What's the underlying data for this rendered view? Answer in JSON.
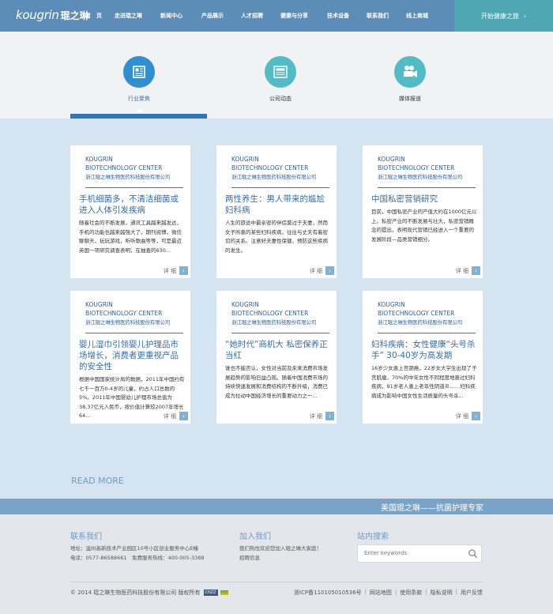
{
  "header": {
    "logo_en": "kougrin",
    "logo_cn": "琨之琳",
    "nav": [
      "首　页",
      "走进琨之琳",
      "新闻中心",
      "产品展示",
      "人才招聘",
      "健康与分享",
      "技术设备",
      "联系我们",
      "线上商城"
    ],
    "cta": "开始健康之旅",
    "cta_arrow": "›"
  },
  "tabs": [
    {
      "label": "行业聚焦",
      "icon": "newspaper-icon",
      "active": true
    },
    {
      "label": "公司动态",
      "icon": "news-document-icon",
      "active": false
    },
    {
      "label": "媒体报道",
      "icon": "video-camera-icon",
      "active": false
    }
  ],
  "brand": {
    "line1": "KOUGRIN",
    "line2": "BIOTECHNOLOGY CENTER",
    "line3": "浙江琨之琳生物医药科技股份有限公司"
  },
  "cards": [
    {
      "title": "手机细菌多，不清洁细菌或进入人体引发疾病",
      "body": "随着社会的不断发展，通讯工具越来越发达，手机的功能也越来越强大了，期刊阅博，微信聊聊天，玩玩游戏，听听歌曲等等，可是最近英国一项研究调查表明，在抽查的630...",
      "more": "详 细"
    },
    {
      "title": "两性养生：男人带来的尴尬妇科病",
      "body": "人生的旅途中最亲密的伴侣莫过于夫妻，然而女子所患的某些妇科疾病，往往与丈夫有着密切的关系。注意好夫妻性保健，预防这些疾病的发生。",
      "more": "详 细"
    },
    {
      "title": "中国私密营销研究",
      "body": "目前，中国私密产业的产值大约在1000亿元以上。私密产业的不断发展与壮大，私密营销概念的提出，表明现代营销已经进入一个重要的发展阶段—品类营销细分。",
      "more": "详 细"
    },
    {
      "title": "婴儿湿巾引领婴儿护理品市场增长，消费者更重视产品的安全性",
      "body": "根据中国国家统计局的数据，2011年中国约有七千一百万0-4岁的儿童，约占人口总数的5%。2011年中国婴幼儿护理市场总值为38.37亿元人民币，按价值计算较2007年增长64...",
      "more": "详 细"
    },
    {
      "title": "“她时代”商机大 私密保养正当红",
      "body": "谁也不能否认，女性对当前及未来消费市场发展趋势的影响日益凸现。随着中国消费市场的持续快速发展和消费结构的不断升级，消费已成为拉动中国经济增长的重要动力之一...",
      "more": "详 细"
    },
    {
      "title": "妇科疾病：女性健康“头号杀手” 30-40岁为高发期",
      "body": "16岁少女患上宫颈癌，22岁女大学生出现了子宫肌瘤，70%的中年女性不同程度地患过妇科疾病，91岁老人患上老年性阴道炎……妇科疾病成为影响中国女性生活质量的头号杀...",
      "more": "详 细"
    }
  ],
  "read_more": "READ MORE",
  "slogan": "美国琨之琳——抗菌护理专家",
  "footer": {
    "contact_title": "联系我们",
    "contact_lines": [
      "地址：温州高新技术产业园区10号小区创业服务中心E幢",
      "电话：0577-86588661　免费服务热线：400-005-3388"
    ],
    "join_title": "加入我们",
    "join_lines": [
      "我们热忱欢迎您加入琨之琳大家庭！",
      "招聘信息"
    ],
    "search_title": "站内搜索",
    "search_placeholder": "Enter keywords",
    "copyright": "© 2014 琨之琳生物医药科技股份有限公司 版权所有",
    "badge": "CNZZ",
    "links": [
      "浙ICP备11010501053​6号",
      "网站地图",
      "使用条款",
      "隐私说明",
      "用户反馈"
    ]
  },
  "colors": {
    "header": "#5b8db8",
    "accent": "#2e76bc",
    "tab_icon_1": "#2f8fd0",
    "tab_icon_2": "#52bcc4",
    "tab_icon_3": "#52bcc4",
    "main_bg": "#d4e4f1"
  }
}
